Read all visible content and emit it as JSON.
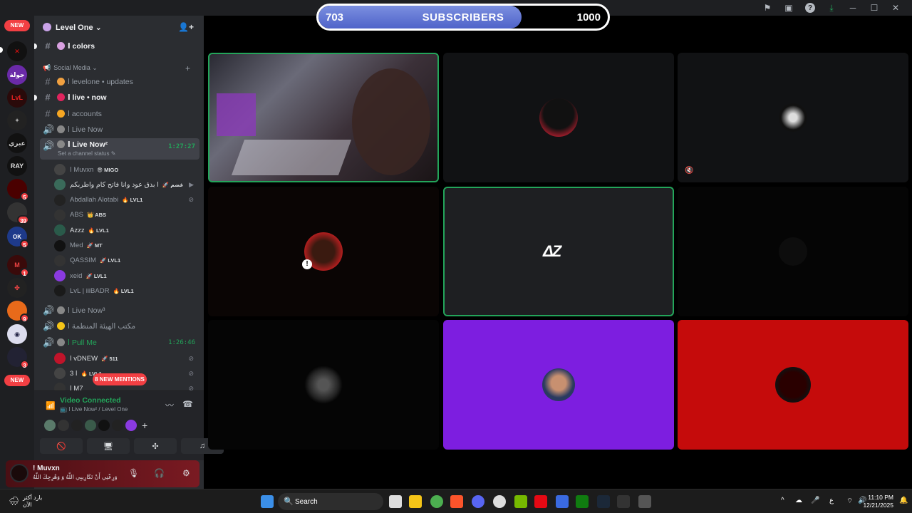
{
  "subscriber_goal": {
    "current": "703",
    "label": "SUBSCRIBERS",
    "target": "1000",
    "progress": 0.703
  },
  "guild": {
    "name": "Level One ⌄"
  },
  "server_rail": {
    "new_top": "NEW",
    "new_bottom": "NEW",
    "badges": [
      "5",
      "39",
      "5",
      "1",
      "9",
      "3"
    ]
  },
  "channels": {
    "colors": "ا colors",
    "category_social": "Social Media ⌄",
    "updates": "ا levelone • updates",
    "live_now_text": "ا live • now",
    "accounts": "ا accounts",
    "live_now_voice": "ا Live Now",
    "live_now2": "ا Live Now²",
    "live_now2_status": "Set a channel status ✎",
    "live_now2_time": "1:27:27",
    "live_now3": "ا Live Now³",
    "office": "مكتب الهيئة المنظمة ا",
    "pull_me": "ا Pull Me",
    "pull_me_time": "1:26:46"
  },
  "voice_users": [
    {
      "name": "ا Muvxn",
      "tag": "😎 MIGO"
    },
    {
      "name": "ا بدق عود وانا فاتح كام واطربكم",
      "tag": "🚀 غضم"
    },
    {
      "name": "Abdallah Alotabi",
      "tag": "🔥 LVL1"
    },
    {
      "name": "ABS",
      "tag": "👑 ABS"
    },
    {
      "name": "Azzz",
      "tag": "🔥 LVL1"
    },
    {
      "name": "Med",
      "tag": "🚀 MT"
    },
    {
      "name": "QASSIM",
      "tag": "🚀 LVL1"
    },
    {
      "name": "xeid",
      "tag": "🚀 LVL1"
    },
    {
      "name": "LvL | iiiBADR",
      "tag": "🔥 LVL1"
    }
  ],
  "pull_users": [
    {
      "name": "ا vDNEW",
      "tag": "🚀 511"
    },
    {
      "name": "ا 3",
      "tag": "🔥 LVL1"
    },
    {
      "name": "ا M7",
      "tag": ""
    }
  ],
  "mentions": "8 NEW MENTIONS",
  "voice_panel": {
    "status": "Video Connected",
    "location": "📺 ا Live Now² / Level One"
  },
  "user_panel": {
    "name": "! Muvxn",
    "status": "وَرِعْنِي أَنْ تَكَارِيبِي اللّهُ وَ وَهْرِجِكَ اللّهُ"
  },
  "taskbar": {
    "search_placeholder": "Search",
    "time": "11:10 PM",
    "date": "12/21/2025",
    "weather_line1": "بارد أكثر",
    "weather_line2": "الآن"
  },
  "colors": {
    "accent_green": "#23a55a",
    "discord_bg": "#2b2d31",
    "tile_purple": "#7d1ee0",
    "tile_red": "#c50b0b"
  }
}
